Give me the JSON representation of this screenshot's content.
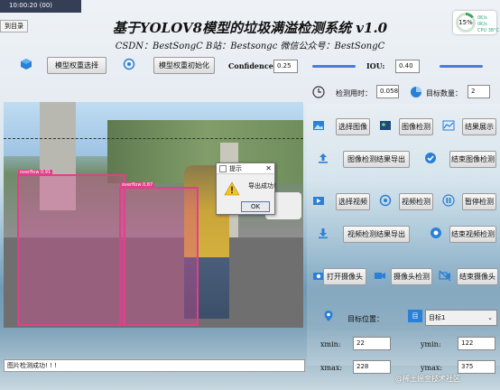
{
  "window": {
    "timestamp": "10:00:20 (00)",
    "tab_label": "到目录"
  },
  "header": {
    "title": "基于YOLOV8模型的垃圾满溢检测系统 v1.0",
    "subtitle": "CSDN：BestSongC   B站：Bestsongc   微信公众号：BestSongC"
  },
  "perf": {
    "percent": "15%",
    "net_up": "0K/s",
    "net_down": "0K/s",
    "cpu": "CPU 38°C"
  },
  "toolbar": {
    "select_model": "模型权重选择",
    "init_model": "模型权重初始化",
    "confidence_label": "Confidence:",
    "confidence_value": "0.25",
    "iou_label": "IOU:",
    "iou_value": "0.40"
  },
  "stats": {
    "time_label": "检测用时：",
    "time_value": "0.058",
    "count_label": "目标数量：",
    "count_value": "2"
  },
  "buttons": {
    "select_image": "选择图像",
    "image_detect": "图像检测",
    "show_result": "结果展示",
    "export_image_result": "图像检测结果导出",
    "end_image_detect": "结束图像检测",
    "select_video": "选择视频",
    "video_detect": "视频检测",
    "pause_detect": "暂停检测",
    "export_video_result": "视频检测结果导出",
    "end_video_detect": "结束视频检测",
    "open_camera": "打开摄像头",
    "camera_detect": "摄像头检测",
    "close_camera": "结束摄像头"
  },
  "target": {
    "label": "目标位置：",
    "select_value": "目标1",
    "xmin_label": "xmin:",
    "xmin": "22",
    "ymin_label": "ymin:",
    "ymin": "122",
    "xmax_label": "xmax:",
    "xmax": "228",
    "ymax_label": "ymax:",
    "ymax": "375"
  },
  "detections": [
    {
      "label": "overflow 0.91"
    },
    {
      "label": "overflow 0.87"
    }
  ],
  "dialog": {
    "title": "提示",
    "message": "导出成功!",
    "ok": "OK"
  },
  "status": {
    "text": "图片检测成功! ! !"
  },
  "watermark": "@稀土掘金技术社区",
  "colors": {
    "bbox": "#e0408a",
    "accent": "#4a7bd8",
    "gauge": "#3aa65a"
  }
}
